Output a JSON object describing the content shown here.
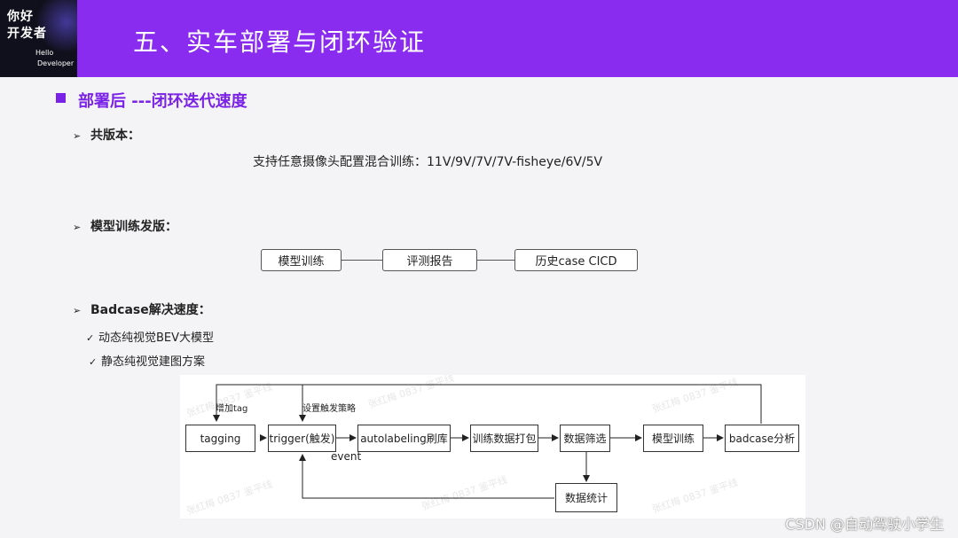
{
  "header": {
    "logo": {
      "line1": "你好",
      "line2": "开发者",
      "en1": "Hello",
      "en2": "Developer"
    },
    "title": "五、实车部署与闭环验证"
  },
  "section_title": "部署后 ---闭环迭代速度",
  "items": {
    "shared_version": "共版本：",
    "support_text": "支持任意摄像头配置混合训练：11V/9V/7V/7V-fisheye/6V/5V",
    "model_release": "模型训练发版：",
    "badcase_speed": "Badcase解决速度："
  },
  "release_flow": [
    "模型训练",
    "评测报告",
    "历史case CICD"
  ],
  "checks": [
    "动态纯视觉BEV大模型",
    "静态纯视觉建图方案"
  ],
  "diagram": {
    "nodes": [
      "tagging",
      "trigger(触发)",
      "autolabeling刷库",
      "训练数据打包",
      "数据筛选",
      "模型训练",
      "badcase分析",
      "数据统计"
    ],
    "label_add_tag": "增加tag",
    "label_trigger_strategy": "设置触发策略",
    "label_event": "event",
    "watermark": "张红梅 0837 鉴平线"
  },
  "footer": "CSDN @自动驾驶小学生",
  "colors": {
    "header": "#8a2cf0",
    "accent": "#7a22e8",
    "background": "#f4f4f6"
  }
}
